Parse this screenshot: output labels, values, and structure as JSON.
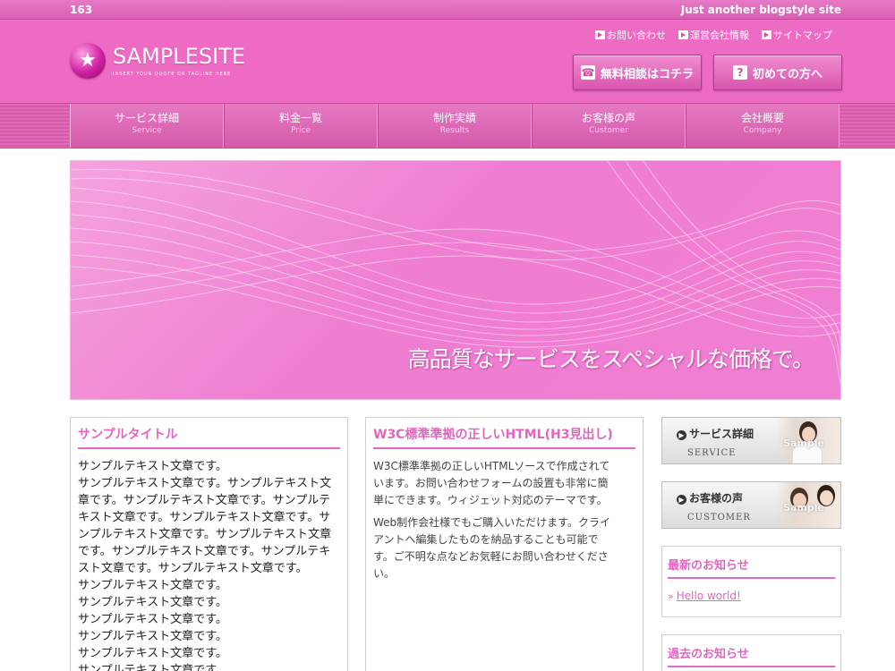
{
  "topbar": {
    "number": "163",
    "tagline": "Just another blogstyle site"
  },
  "logo": {
    "text": "SAMPLESITE",
    "subtext": "INSERT YOUR QUOTE OR TAGLINE HERE",
    "icon": "star-icon"
  },
  "toplinks": [
    {
      "label": "お問い合わせ"
    },
    {
      "label": "運営会社情報"
    },
    {
      "label": "サイトマップ"
    }
  ],
  "header_buttons": {
    "consult": {
      "label": "無料相談はコチラ",
      "icon": "phone-icon"
    },
    "first": {
      "label": "初めての方へ",
      "icon": "question-icon"
    }
  },
  "nav": [
    {
      "jp": "サービス詳細",
      "en": "Service"
    },
    {
      "jp": "料金一覧",
      "en": "Price"
    },
    {
      "jp": "制作実績",
      "en": "Results"
    },
    {
      "jp": "お客様の声",
      "en": "Customer"
    },
    {
      "jp": "会社概要",
      "en": "Company"
    }
  ],
  "hero": {
    "caption": "高品質なサービスをスペシャルな価格で。"
  },
  "box1": {
    "title": "サンプルタイトル",
    "lines": [
      "サンプルテキスト文章です。",
      "サンプルテキスト文章です。サンプルテキスト文",
      "章です。サンプルテキスト文章です。サンプルテ",
      "キスト文章です。サンプルテキスト文章です。サ",
      "ンプルテキスト文章です。サンプルテキスト文章",
      "です。サンプルテキスト文章です。サンプルテキ",
      "スト文章です。サンプルテキスト文章です。",
      "サンプルテキスト文章です。",
      "サンプルテキスト文章です。",
      "サンプルテキスト文章です。",
      "サンプルテキスト文章です。",
      "サンプルテキスト文章です。",
      "サンプルテキスト文章です。"
    ]
  },
  "box2": {
    "title": "W3C標準準拠の正しいHTML(H3見出し)",
    "para1_lines": [
      "W3C標準準拠の正しいHTMLソースで作成されて",
      "います。お問い合わせフォームの設置も非常に簡",
      "単にできます。ウィジェット対応のテーマです。"
    ],
    "para2_lines": [
      "Web制作会社様でもご購入いただけます。クライ",
      "アントへ編集したものを納品することも可能で",
      "す。ご不明な点などお気軽にお問い合わせくださ",
      "い。"
    ]
  },
  "sidebar": {
    "banner_service": {
      "title": "サービス詳細",
      "sub": "SERVICE",
      "watermark": "Sample"
    },
    "banner_customer": {
      "title": "お客様の声",
      "sub": "CUSTOMER",
      "watermark": "Sample"
    },
    "news": {
      "title": "最新のお知らせ",
      "link": "Hello world!"
    },
    "archive": {
      "title": "過去のお知らせ"
    }
  },
  "colors": {
    "accent": "#e564c0",
    "header_bg": "#ee6bc4"
  }
}
